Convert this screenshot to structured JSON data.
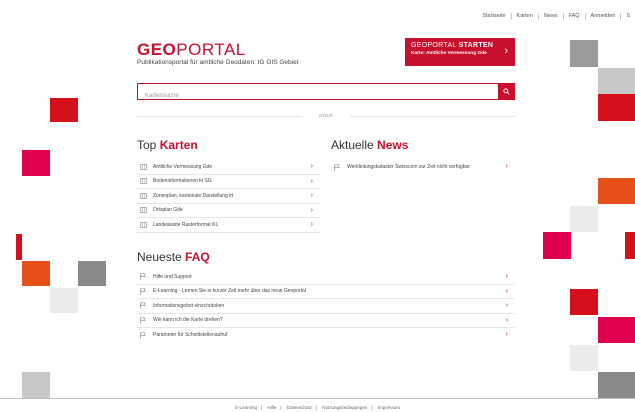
{
  "topnav": {
    "items": [
      "Startseite",
      "Karten",
      "News",
      "FAQ",
      "Anmelden",
      "S"
    ]
  },
  "header": {
    "logo_bold": "GEO",
    "logo_rest": "PORTAL",
    "subtitle": "Publikationsportal für amtliche Geodaten: IG GIS Gebiet"
  },
  "cta": {
    "title_light": "GEOPORTAL",
    "title_bold": "STARTEN",
    "subtitle": "Karte: Amtliche Vermessung Gde"
  },
  "search": {
    "placeholder": "Kartensuche"
  },
  "divider": {
    "label": "ODER"
  },
  "top_karten": {
    "title_light": "Top",
    "title_bold": "Karten",
    "items": [
      "Amtliche Vermessung Gde",
      "Bodeninformationen kt SG",
      "Zonenplan, kantonale Darstellung kt",
      "Ortsplan Gde",
      "Landeskarte Rasterformat KL"
    ]
  },
  "aktuelle_news": {
    "title_light": "Aktuelle",
    "title_bold": "News",
    "items": [
      "Werkleitungskataster Swisscom zur Zeit nicht verfügbar"
    ]
  },
  "faq": {
    "title_light": "Neueste",
    "title_bold": "FAQ",
    "items": [
      "Hilfe und Support",
      "E-Learning - Lernen Sie in kurzer Zeit mehr über das neue Geoportal",
      "Informationsgebot einschränken",
      "Wie kann ich die Karte drehen?",
      "Parameter für Schnittstellenaufruf"
    ]
  },
  "footer": {
    "items": [
      "E-Learning",
      "Hilfe",
      "Datenschutz",
      "Nutzungsbedingungen",
      "Impressum"
    ]
  },
  "colors": {
    "accent": "#c8102e",
    "pink": "#e0004f",
    "orange": "#e8501a",
    "gray_dark": "#8a8a8a",
    "gray_mid": "#c8c8c8",
    "gray_light": "#ececec"
  }
}
